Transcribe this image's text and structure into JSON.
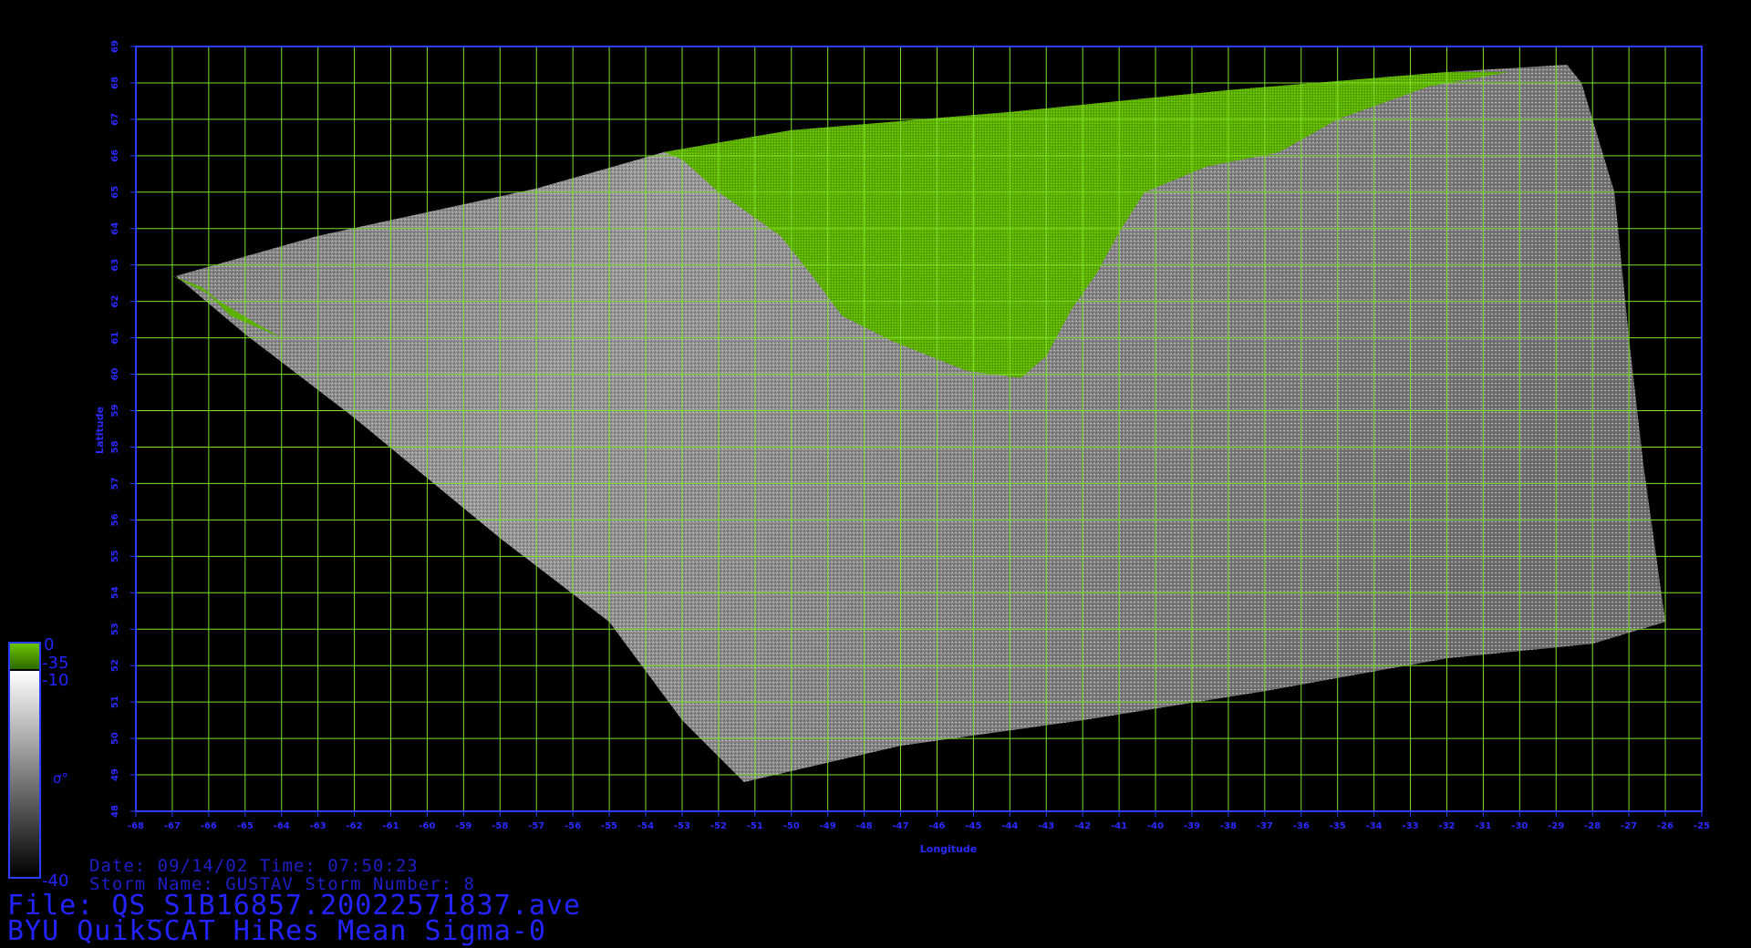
{
  "map": {
    "xlabel": "Longitude",
    "ylabel": "Latitude",
    "lon_range": [
      -68,
      -25
    ],
    "lat_range": [
      48,
      69
    ],
    "lon_ticks": [
      "-68",
      "-67",
      "-66",
      "-65",
      "-64",
      "-63",
      "-62",
      "-61",
      "-60",
      "-59",
      "-58",
      "-57",
      "-56",
      "-55",
      "-54",
      "-53",
      "-52",
      "-51",
      "-50",
      "-49",
      "-48",
      "-47",
      "-46",
      "-45",
      "-44",
      "-43",
      "-42",
      "-41",
      "-40",
      "-39",
      "-38",
      "-37",
      "-36",
      "-35",
      "-34",
      "-33",
      "-32",
      "-31",
      "-30",
      "-29",
      "-28",
      "-27",
      "-26",
      "-25"
    ],
    "lat_ticks": [
      "48",
      "49",
      "50",
      "51",
      "52",
      "53",
      "54",
      "55",
      "56",
      "57",
      "58",
      "59",
      "60",
      "61",
      "62",
      "63",
      "64",
      "65",
      "66",
      "67",
      "68",
      "69"
    ],
    "grid": true,
    "colors": {
      "frame": "#2a3cff",
      "grid": "#7ee02a",
      "tick_text": "#2a2aff",
      "land": "#5bb000",
      "ocean_light": "#c8c8c8",
      "ocean_dark": "#3c3c3c"
    },
    "swath_outline": [
      [
        -66.9,
        62.7
      ],
      [
        -63.0,
        63.8
      ],
      [
        -57.0,
        65.1
      ],
      [
        -53.5,
        66.1
      ],
      [
        -50.0,
        66.7
      ],
      [
        -44.0,
        67.2
      ],
      [
        -38.0,
        67.8
      ],
      [
        -32.0,
        68.3
      ],
      [
        -28.7,
        68.5
      ],
      [
        -28.3,
        68.0
      ],
      [
        -27.4,
        65.0
      ],
      [
        -27.0,
        61.0
      ],
      [
        -26.6,
        57.5
      ],
      [
        -26.0,
        53.2
      ],
      [
        -28.0,
        52.6
      ],
      [
        -32.0,
        52.2
      ],
      [
        -37.0,
        51.3
      ],
      [
        -42.0,
        50.5
      ],
      [
        -47.0,
        49.8
      ],
      [
        -51.3,
        48.8
      ],
      [
        -53.0,
        50.5
      ],
      [
        -55.0,
        53.2
      ],
      [
        -58.0,
        55.5
      ],
      [
        -62.0,
        58.8
      ],
      [
        -65.0,
        61.1
      ],
      [
        -66.9,
        62.7
      ]
    ],
    "greenland_outline": [
      [
        -53.5,
        66.1
      ],
      [
        -50.0,
        66.7
      ],
      [
        -44.0,
        67.2
      ],
      [
        -38.0,
        67.8
      ],
      [
        -32.0,
        68.3
      ],
      [
        -30.3,
        68.3
      ],
      [
        -32.5,
        67.9
      ],
      [
        -35.0,
        67.0
      ],
      [
        -36.6,
        66.1
      ],
      [
        -38.6,
        65.7
      ],
      [
        -40.3,
        65.0
      ],
      [
        -41.0,
        63.9
      ],
      [
        -41.6,
        62.8
      ],
      [
        -42.3,
        61.8
      ],
      [
        -43.0,
        60.5
      ],
      [
        -43.7,
        59.9
      ],
      [
        -45.2,
        60.1
      ],
      [
        -47.2,
        60.9
      ],
      [
        -48.6,
        61.6
      ],
      [
        -49.5,
        62.8
      ],
      [
        -50.3,
        63.8
      ],
      [
        -51.0,
        64.3
      ],
      [
        -52.0,
        65.0
      ],
      [
        -53.0,
        65.9
      ],
      [
        -53.5,
        66.1
      ]
    ],
    "labrador_coast": [
      [
        -67.0,
        62.7
      ],
      [
        -66.2,
        62.4
      ],
      [
        -65.7,
        62.0
      ],
      [
        -64.7,
        61.4
      ],
      [
        -64.0,
        61.0
      ],
      [
        -65.4,
        61.6
      ],
      [
        -66.0,
        62.2
      ],
      [
        -67.0,
        62.7
      ]
    ],
    "colorbar": {
      "label": "σ°",
      "tick_top": "0",
      "tick_land": "-35",
      "tick_high": "-10",
      "tick_bottom": "-40"
    }
  },
  "info": {
    "line1": "Date: 09/14/02   Time: 07:50:23",
    "line2": "Storm Name: GUSTAV   Storm Number: 8",
    "file": "File: QS_S1B16857.20022571837.ave",
    "title": "BYU QuikSCAT HiRes Mean Sigma-0"
  }
}
